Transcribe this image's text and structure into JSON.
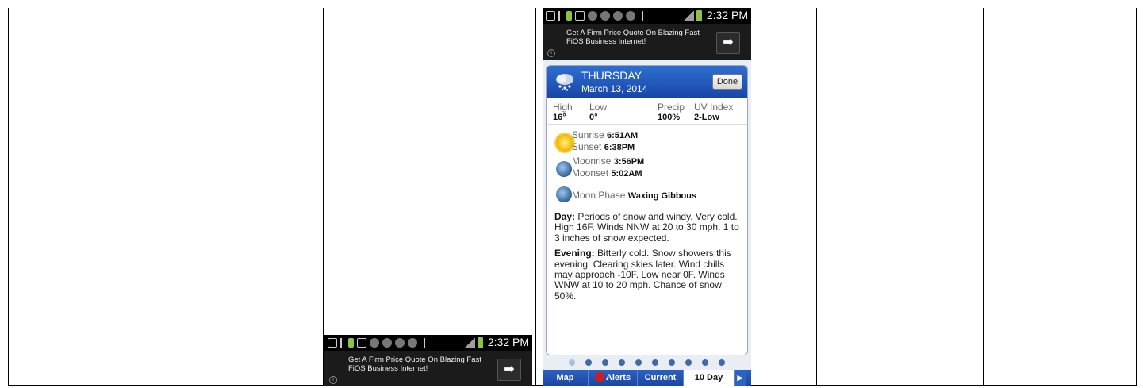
{
  "status_bar": {
    "time": "2:32 PM"
  },
  "ad": {
    "text": "Get A Firm Price Quote On Blazing Fast FiOS Business Internet!",
    "arrow": "➡",
    "info": "i"
  },
  "detail": {
    "day": "THURSDAY",
    "date": "March 13, 2014",
    "done_label": "Done",
    "stats": [
      {
        "label": "High",
        "value": "16°"
      },
      {
        "label": "Low",
        "value": "0°"
      },
      {
        "label": "Precip",
        "value": "100%"
      },
      {
        "label": "UV Index",
        "value": "2-Low"
      }
    ],
    "sunrise_label": "Sunrise",
    "sunrise": "6:51AM",
    "sunset_label": "Sunset",
    "sunset": "6:38PM",
    "moonrise_label": "Moonrise",
    "moonrise": "3:56PM",
    "moonset_label": "Moonset",
    "moonset": "5:02AM",
    "moon_phase_label": "Moon Phase",
    "moon_phase": "Waxing Gibbous",
    "day_label": "Day:",
    "day_text": "Periods of snow and windy. Very cold. High 16F. Winds NNW at 20 to 30 mph. 1 to 3 inches of snow expected.",
    "evening_label": "Evening:",
    "evening_text": "Bitterly cold. Snow showers this evening. Clearing skies later. Wind chills may approach -10F. Low near 0F. Winds WNW at 10 to 20 mph. Chance of snow 50%."
  },
  "tabs": {
    "map": "Map",
    "alerts": "Alerts",
    "current": "Current",
    "ten_day": "10 Day",
    "next": "▶"
  },
  "icons": {
    "weather": "snow-cloud-icon",
    "sun": "sun-icon",
    "moon": "moon-icon"
  },
  "colors": {
    "header_blue": "#1f55b8",
    "page_dot": "#3d6aa8",
    "page_dot_active": "#a8c0de"
  }
}
